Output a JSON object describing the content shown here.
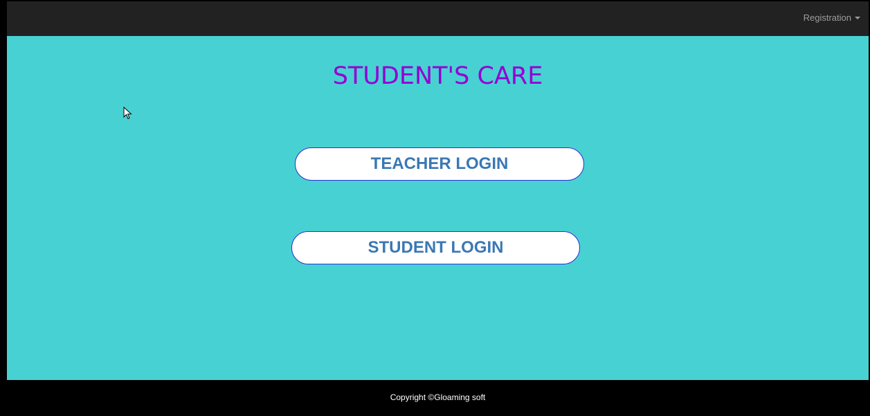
{
  "navbar": {
    "registration_label": "Registration",
    "registration_icon": "caret-down-icon"
  },
  "main": {
    "title": "STUDENT'S CARE",
    "teacher_login_label": "TEACHER LOGIN",
    "student_login_label": "STUDENT LOGIN"
  },
  "footer": {
    "copyright": "Copyright ©Gloaming soft"
  },
  "colors": {
    "navbar_bg": "#222222",
    "main_bg": "#48d1d2",
    "title": "#9400d3",
    "button_text": "#3a78b4",
    "button_border": "#2b2bd8",
    "footer_bg": "#000000"
  }
}
